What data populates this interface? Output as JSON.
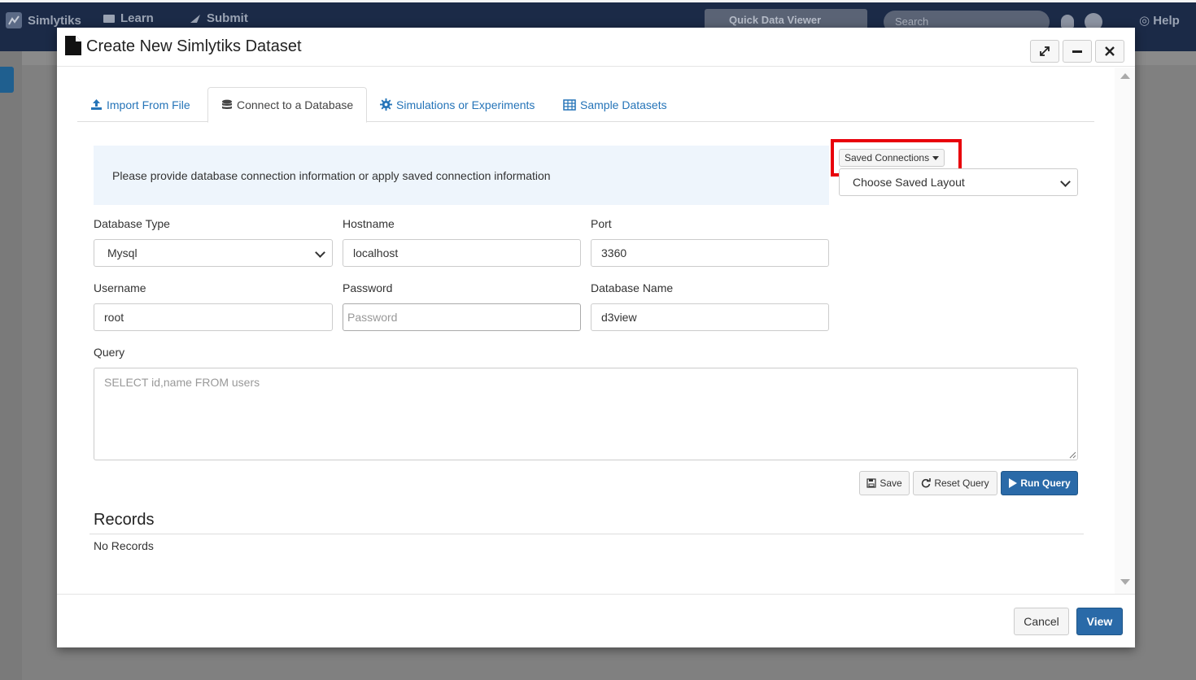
{
  "background": {
    "nav": [
      "Simlytiks",
      "Learn",
      "Submit"
    ],
    "quick_data_viewer": "Quick Data Viewer",
    "search_placeholder": "Search",
    "help": "Help"
  },
  "modal": {
    "title": "Create New Simlytiks Dataset",
    "tabs": [
      {
        "label": "Import From File",
        "icon": "upload-icon"
      },
      {
        "label": "Connect to a Database",
        "icon": "database-icon"
      },
      {
        "label": "Simulations or Experiments",
        "icon": "gear-icon"
      },
      {
        "label": "Sample Datasets",
        "icon": "table-icon"
      }
    ],
    "info": "Please provide database connection information or apply saved connection information",
    "saved_connections_label": "Saved Connections",
    "saved_layout_value": "Choose Saved Layout",
    "form": {
      "db_type_label": "Database Type",
      "db_type_value": "Mysql",
      "hostname_label": "Hostname",
      "hostname_value": "localhost",
      "port_label": "Port",
      "port_value": "3360",
      "username_label": "Username",
      "username_value": "root",
      "password_label": "Password",
      "password_placeholder": "Password",
      "dbname_label": "Database Name",
      "dbname_value": "d3view",
      "query_label": "Query",
      "query_placeholder": "SELECT id,name FROM users"
    },
    "actions": {
      "save": "Save",
      "reset": "Reset Query",
      "run": "Run Query"
    },
    "records_title": "Records",
    "records_empty": "No Records",
    "footer": {
      "cancel": "Cancel",
      "view": "View"
    }
  },
  "colors": {
    "primary": "#2a6aa8",
    "link": "#2574b8",
    "highlight": "#e8000b",
    "info_bg": "#eef5fc"
  }
}
